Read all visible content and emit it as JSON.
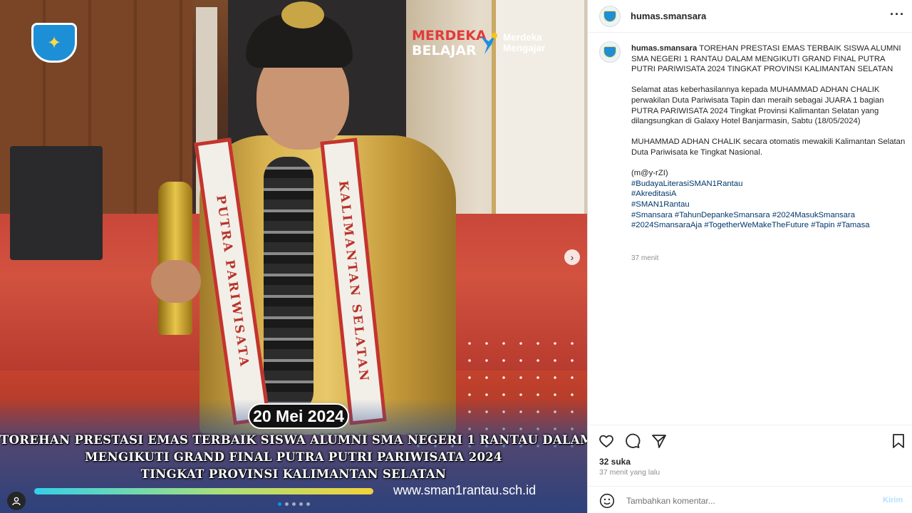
{
  "media": {
    "date_badge": "20 Mei 2024",
    "caption_lines": [
      "TOREHAN PRESTASI EMAS TERBAIK SISWA ALUMNI  SMA NEGERI 1 RANTAU DALAM",
      "MENGIKUTI GRAND FINAL PUTRA PUTRI PARIWISATA 2024",
      "TINGKAT PROVINSI KALIMANTAN SELATAN"
    ],
    "website": "www.sman1rantau.sch.id",
    "logo_merdeka_belajar": [
      "MERDEKA",
      "BELAJAR"
    ],
    "logo_merdeka_mengajar": [
      "Merdeka",
      "Mengajar"
    ],
    "sash_left_text": "PUTRA PARIWISATA",
    "sash_right_text": "KALIMANTAN SELATAN",
    "carousel_count": 5,
    "carousel_active": 0
  },
  "header": {
    "username": "humas.smansara",
    "more_icon": "more-horizontal-icon"
  },
  "post": {
    "username": "humas.smansara",
    "title": "TOREHAN PRESTASI EMAS TERBAIK SISWA ALUMNI SMA NEGERI 1 RANTAU DALAM MENGIKUTI GRAND FINAL PUTRA PUTRI PARIWISATA 2024 TINGKAT PROVINSI KALIMANTAN SELATAN",
    "paragraph1": "Selamat atas keberhasilannya kepada MUHAMMAD ADHAN CHALIK perwakilan Duta Pariwisata Tapin dan meraih sebagai JUARA 1 bagian PUTRA PARIWISATA 2024 Tingkat Provinsi Kalimantan Selatan yang dilangsungkan di Galaxy Hotel Banjarmasin, Sabtu (18/05/2024)",
    "paragraph2": "MUHAMMAD ADHAN CHALIK secara otomatis mewakili Kalimantan Selatan Duta Pariwisata ke Tingkat Nasional.",
    "signature": "(m@y-rZI)",
    "hashtags": {
      "line1": "#BudayaLiterasiSMAN1Rantau",
      "line2": "#AkreditasiA",
      "line3": "#SMAN1Rantau",
      "line4": "#Smansara #TahunDepankeSmansara #2024MasukSmansara",
      "line5": "#2024SmansaraAja #TogetherWeMakeTheFuture #Tapin #Tamasa"
    },
    "time_ago": "37 menit"
  },
  "actions": {
    "likes": "32 suka",
    "posted": "37 menit yang lalu",
    "comment_placeholder": "Tambahkan komentar...",
    "post_label": "Kirim"
  },
  "colors": {
    "link": "#00376b",
    "accent": "#0095f6",
    "muted": "#8e8e8e"
  }
}
